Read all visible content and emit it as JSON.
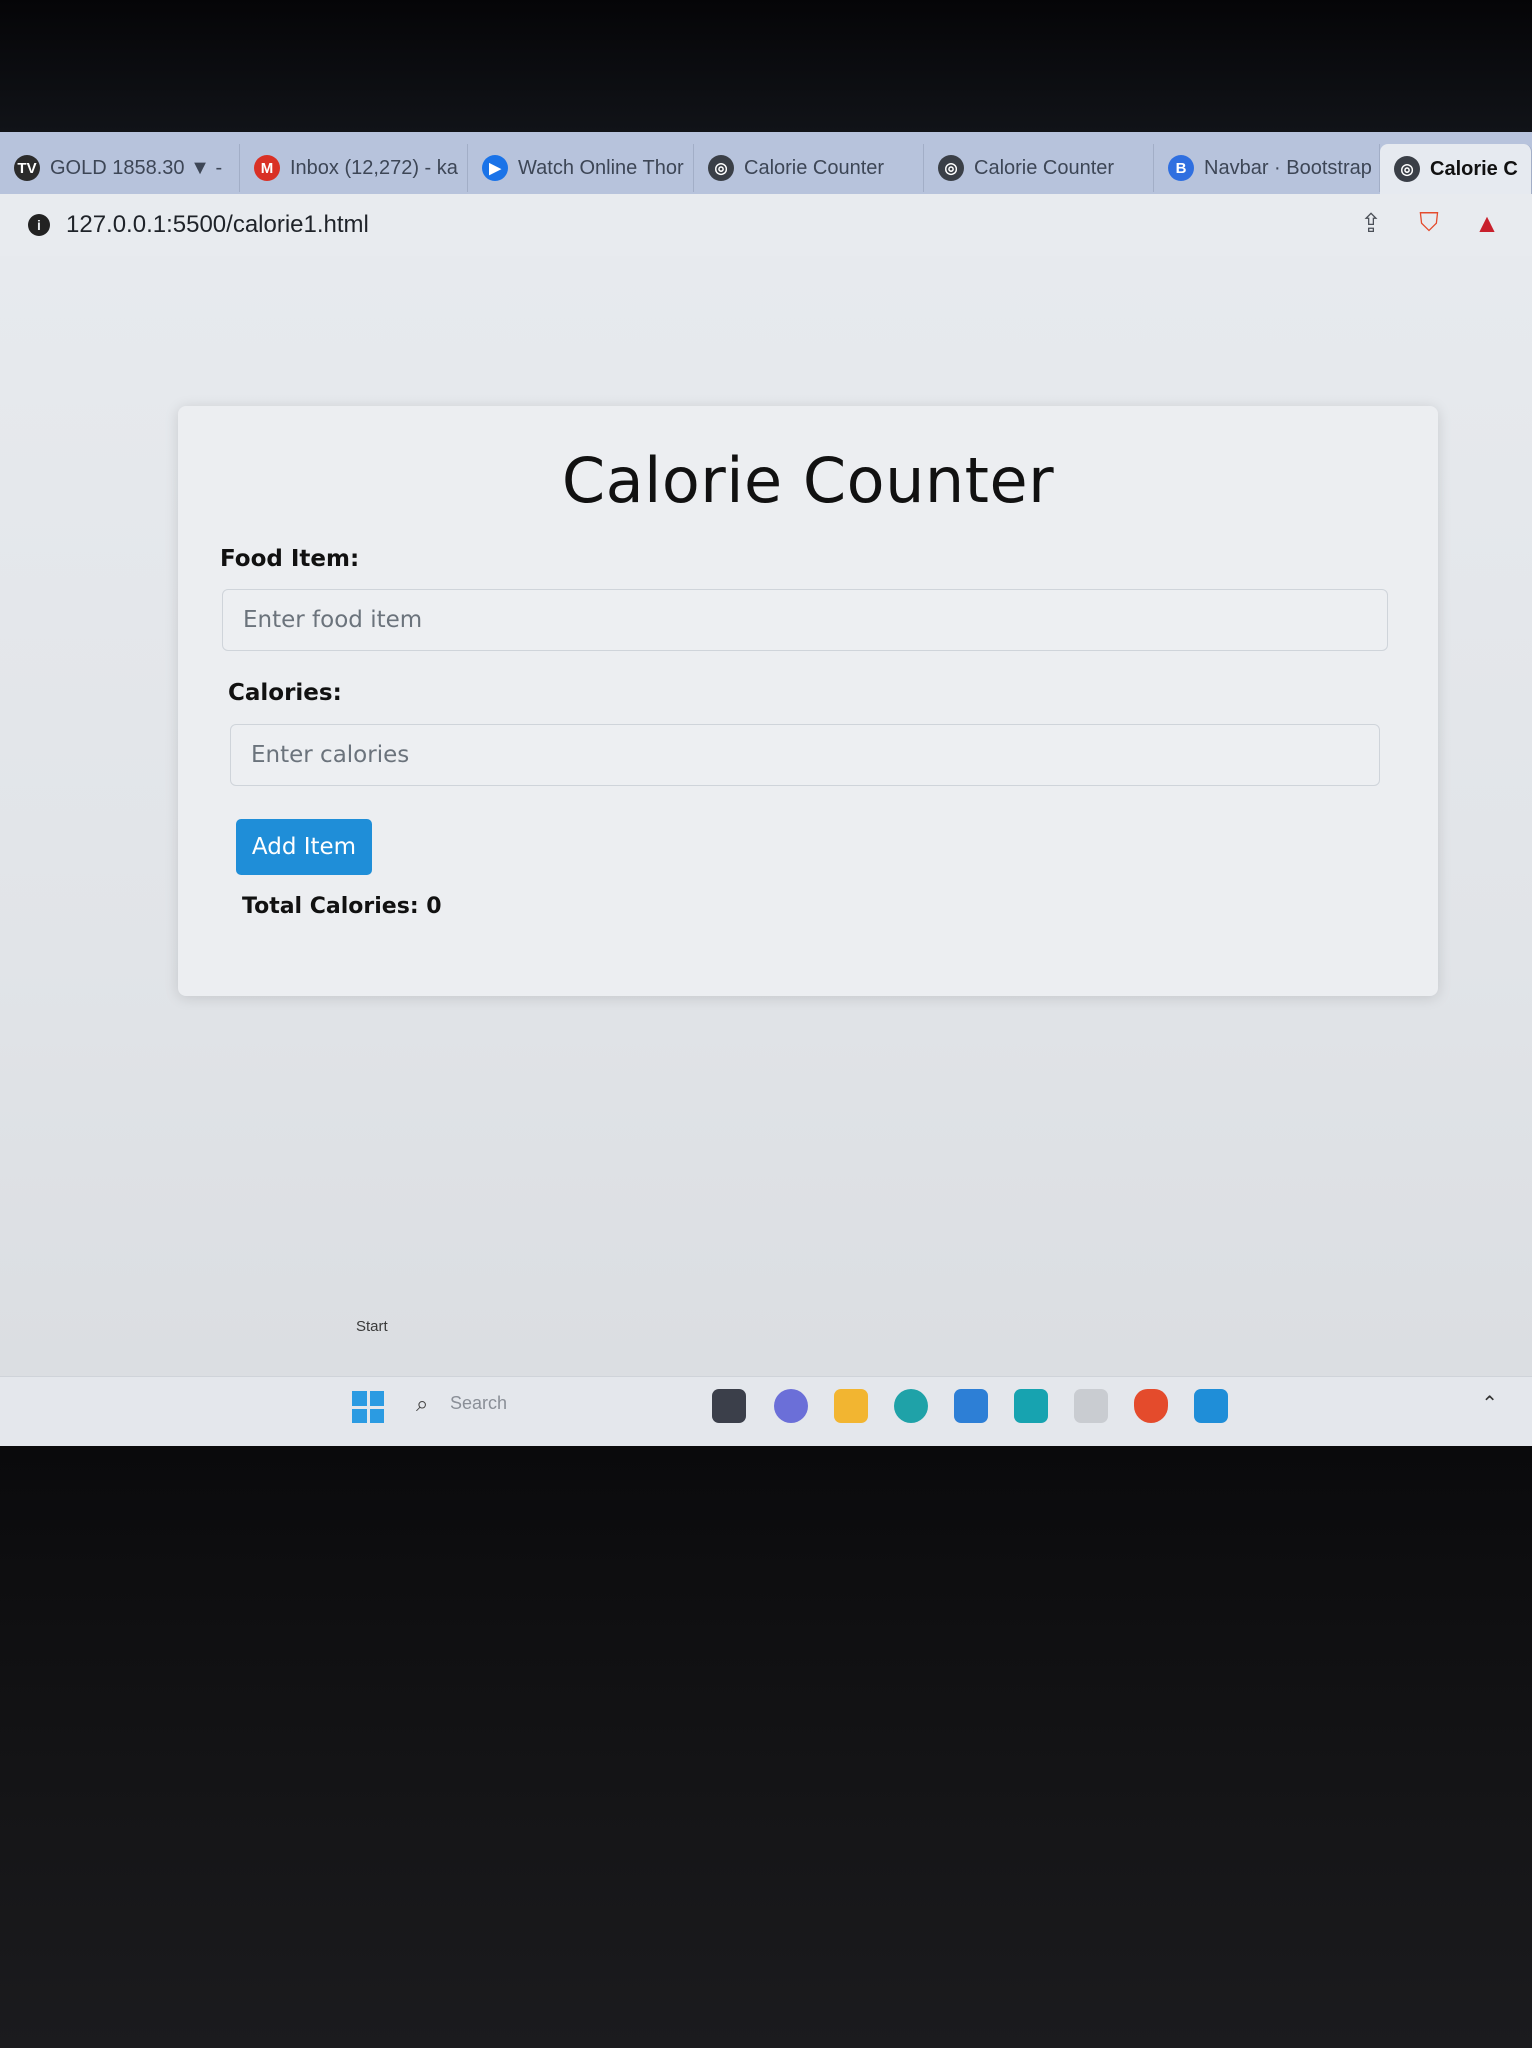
{
  "browser": {
    "tabs": [
      {
        "label": "GOLD 1858.30 ▼ -",
        "icon": "tv-icon",
        "icon_glyph": "TV",
        "icon_color": "#2b2b2b"
      },
      {
        "label": "Inbox (12,272) - ka",
        "icon": "gmail-icon",
        "icon_glyph": "M",
        "icon_color": "#d93025"
      },
      {
        "label": "Watch Online Thor",
        "icon": "play-icon",
        "icon_glyph": "▶",
        "icon_color": "#1a73e8"
      },
      {
        "label": "Calorie Counter",
        "icon": "globe-icon",
        "icon_glyph": "◎",
        "icon_color": "#3a3f47"
      },
      {
        "label": "Calorie Counter",
        "icon": "globe-icon",
        "icon_glyph": "◎",
        "icon_color": "#3a3f47"
      },
      {
        "label": "Navbar · Bootstrap",
        "icon": "bootstrap-icon",
        "icon_glyph": "B",
        "icon_color": "#2f6fe0"
      },
      {
        "label": "Calorie C",
        "icon": "globe-icon",
        "icon_glyph": "◎",
        "icon_color": "#3a3f47",
        "active": true
      }
    ],
    "url": "127.0.0.1:5500/calorie1.html"
  },
  "page": {
    "title": "Calorie Counter",
    "food_label": "Food Item:",
    "food_placeholder": "Enter food item",
    "calories_label": "Calories:",
    "calories_placeholder": "Enter calories",
    "add_button": "Add Item",
    "total": "Total Calories: 0"
  },
  "taskbar": {
    "start_tooltip": "Start",
    "search_placeholder": "Search"
  },
  "colors": {
    "button": "#1f8ed8",
    "tab_strip": "#b7c3dc"
  }
}
